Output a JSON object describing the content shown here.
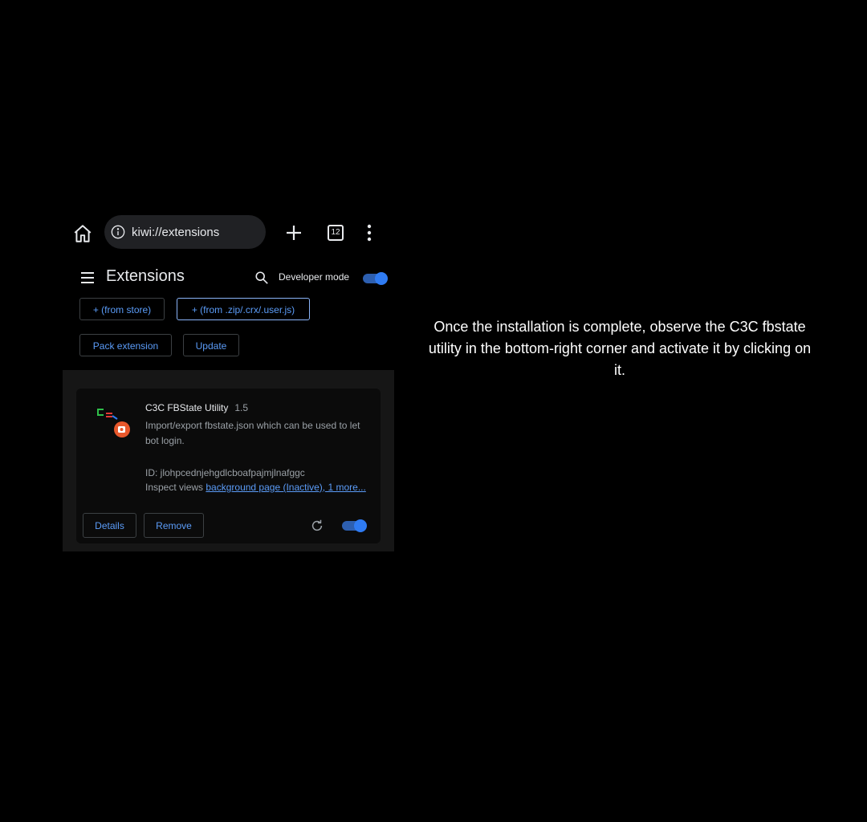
{
  "browser": {
    "url": "kiwi://extensions",
    "tab_count": "12"
  },
  "extensions_page": {
    "title": "Extensions",
    "developer_mode_label": "Developer mode",
    "developer_mode_enabled": true,
    "buttons": {
      "from_store": "+ (from store)",
      "from_zip": "+ (from .zip/.crx/.user.js)",
      "pack_extension": "Pack extension",
      "update": "Update"
    }
  },
  "extension_card": {
    "name": "C3C FBState Utility",
    "version": "1.5",
    "description": "Import/export fbstate.json which can be used to let bot login.",
    "id_text": "ID: jlohpcednjehgdlcboafpajmjlnafggc",
    "inspect_label": "Inspect views",
    "inspect_link": "background page (Inactive), 1 more...",
    "details_label": "Details",
    "remove_label": "Remove",
    "enabled": true
  },
  "instruction": "Once the installation is complete, observe the C3C fbstate utility in the bottom-right corner and activate it by clicking on it.",
  "colors": {
    "accent": "#5b9cf8",
    "toggle_knob": "#2f7bf2",
    "background": "#000000",
    "card": "#0b0b0b"
  }
}
